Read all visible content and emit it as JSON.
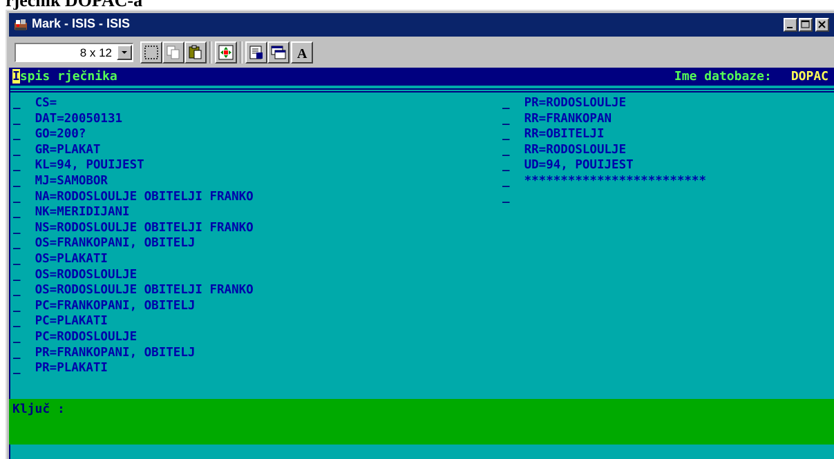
{
  "page_heading": "rječnik DOPAC-a",
  "window": {
    "title": "Mark - ISIS - ISIS",
    "icon": "isis-app-icon",
    "controls": [
      "minimize-icon",
      "maximize-icon",
      "close-icon"
    ]
  },
  "toolbar": {
    "font_size_value": "8 x 12",
    "buttons": [
      "select-icon",
      "copy-icon",
      "paste-icon",
      "fullscreen-icon",
      "properties-icon",
      "background-icon",
      "font-icon"
    ],
    "font_button_label": "A"
  },
  "screen": {
    "header_title_first": "I",
    "header_title_rest": "spis rječnika",
    "db_label": "Ime datobaze:",
    "db_name": "DOPAC",
    "marker": "_",
    "left_entries": [
      "CS=",
      "DAT=20050131",
      "GO=200?",
      "GR=PLAKAT",
      "KL=94, POUIJEST",
      "MJ=SAMOBOR",
      "NA=RODOSLOULJE OBITELJI FRANKO",
      "NK=MERIDIJANI",
      "NS=RODOSLOULJE OBITELJI FRANKO",
      "OS=FRANKOPANI, OBITELJ",
      "OS=PLAKATI",
      "OS=RODOSLOULJE",
      "OS=RODOSLOULJE OBITELJI FRANKO",
      "PC=FRANKOPANI, OBITELJ",
      "PC=PLAKATI",
      "PC=RODOSLOULJE",
      "PR=FRANKOPANI, OBITELJ",
      "PR=PLAKATI"
    ],
    "right_entries": [
      "PR=RODOSLOULJE",
      "RR=FRANKOPAN",
      "RR=OBITELJI",
      "RR=RODOSLOULJE",
      "UD=94, POUIJEST",
      "*************************",
      ""
    ],
    "key_prompt": "Ključ :"
  },
  "colors": {
    "console_bg": "#00aaaa",
    "header_bg": "#000080",
    "entry_text": "#0000aa",
    "key_bar_bg": "#00aa00",
    "title_bar": "#0a246a"
  }
}
